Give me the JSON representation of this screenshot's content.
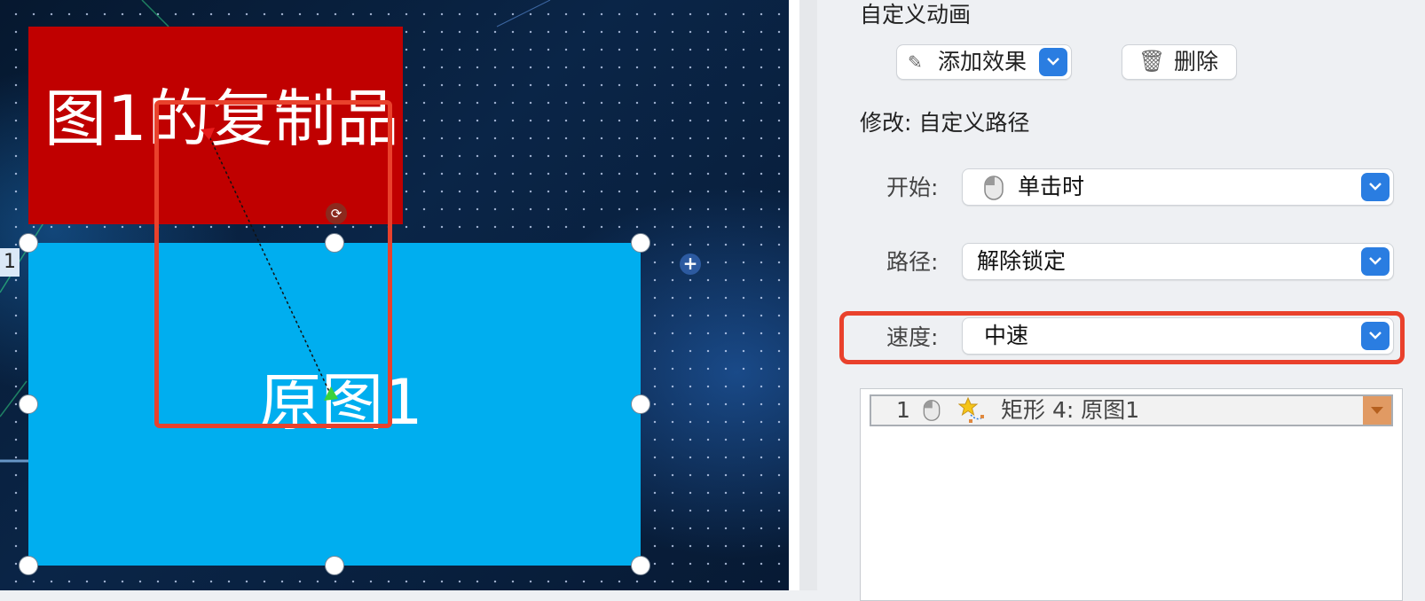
{
  "slide": {
    "copy_shape_text": "图1的复制品",
    "original_shape_text": "原图1",
    "animation_tag": "1",
    "colors": {
      "copy_fill": "#c00000",
      "original_fill": "#00aeef",
      "highlight": "#e9412c"
    }
  },
  "panel": {
    "title": "自定义动画",
    "add_effect_label": "添加效果",
    "delete_label": "删除",
    "modify_label": "修改: 自定义路径",
    "start": {
      "label": "开始:",
      "value": "单击时",
      "icon": "mouse-icon"
    },
    "path": {
      "label": "路径:",
      "value": "解除锁定"
    },
    "speed": {
      "label": "速度:",
      "value": "中速"
    },
    "animation_list": [
      {
        "index": "1",
        "trigger_icon": "mouse-icon",
        "effect_icon": "star-path-icon",
        "name": "矩形 4: 原图1"
      }
    ],
    "colors": {
      "accent": "#2a7de1",
      "item_dropdown": "#e19a63"
    }
  }
}
